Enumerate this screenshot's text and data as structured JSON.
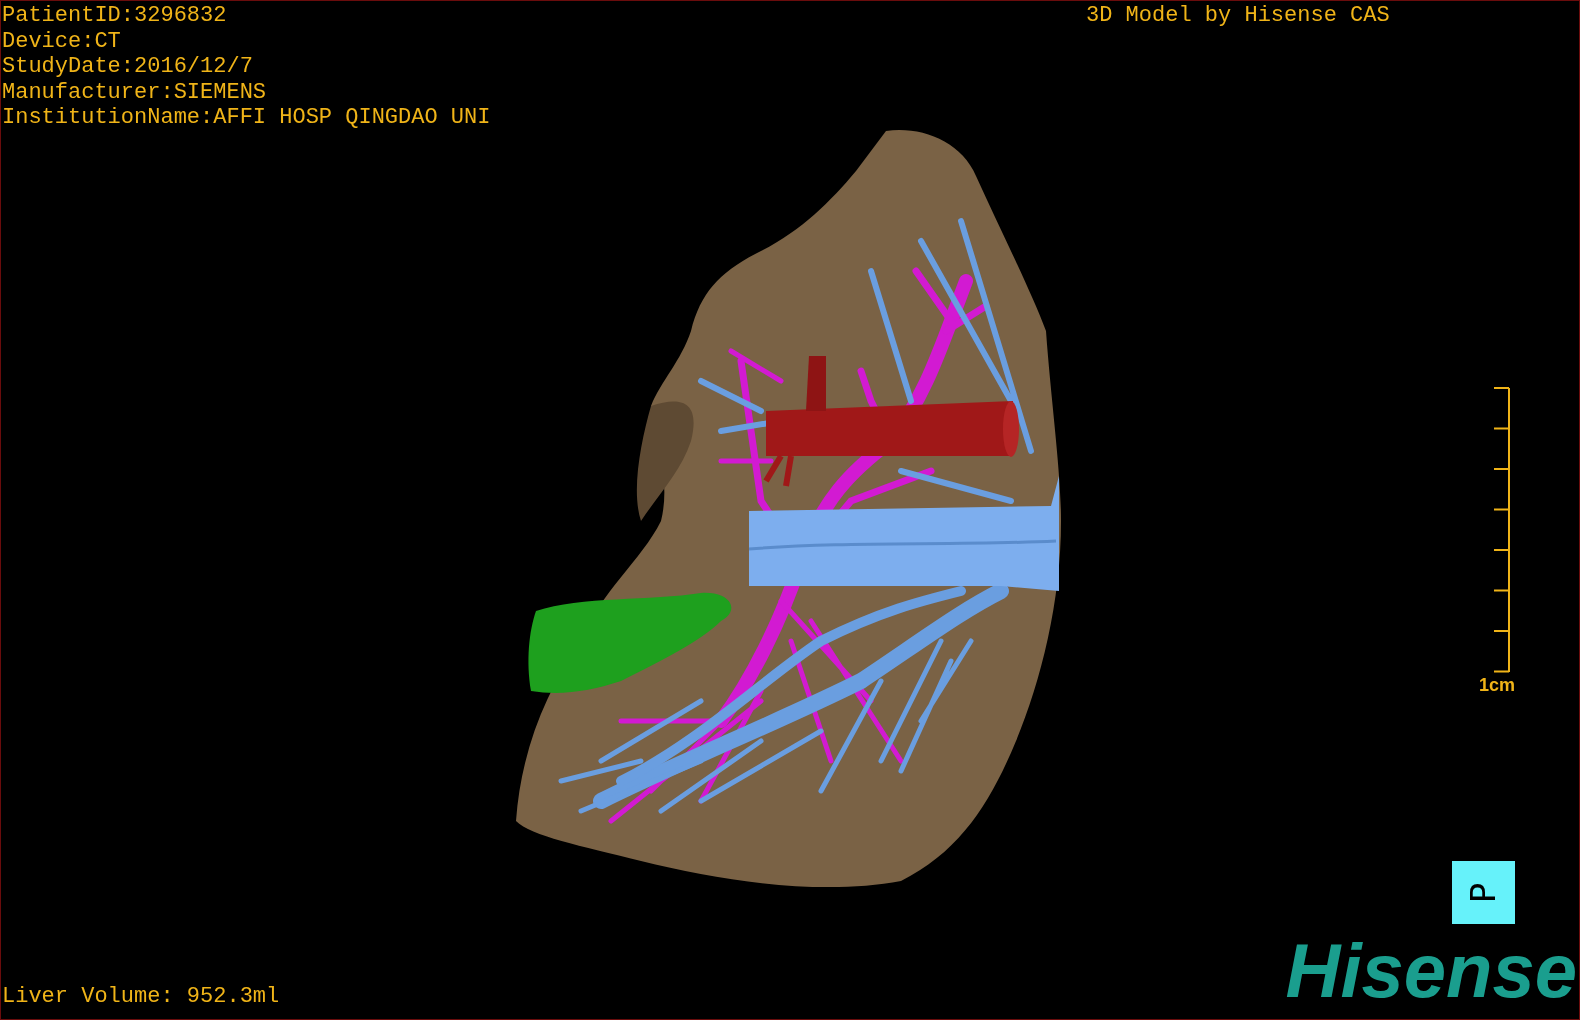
{
  "patient_info": [
    "PatientID:3296832",
    "Device:CT",
    "StudyDate:2016/12/7",
    "Manufacturer:SIEMENS",
    "InstitutionName:AFFI HOSP QINGDAO UNI"
  ],
  "model_title": "3D Model by Hisense CAS",
  "scale_bar": {
    "label": "1cm"
  },
  "orientation_marker": {
    "label": "P"
  },
  "liver_volume": "Liver Volume: 952.3ml",
  "logo": "Hisense"
}
